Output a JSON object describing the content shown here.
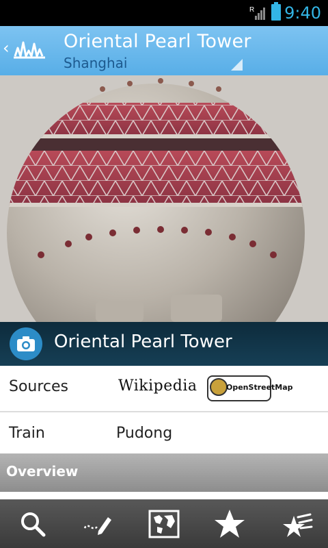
{
  "status_bar": {
    "time": "9:40",
    "signal_label": "R"
  },
  "header": {
    "title": "Oriental Pearl Tower",
    "subtitle": "Shanghai",
    "back_icon": "chevron-left-icon",
    "logo_icon": "city-skyline-icon"
  },
  "caption": {
    "title": "Oriental Pearl Tower",
    "icon": "camera-icon"
  },
  "rows": [
    {
      "label": "Sources",
      "wikipedia": "Wikipedia",
      "osm": "OpenStreetMap"
    },
    {
      "label": "Train",
      "value": "Pudong"
    }
  ],
  "overview": {
    "label": "Overview"
  },
  "nav": {
    "items": [
      {
        "icon": "search-icon"
      },
      {
        "icon": "edit-route-icon"
      },
      {
        "icon": "map-icon"
      },
      {
        "icon": "star-icon"
      },
      {
        "icon": "favorites-icon"
      }
    ]
  },
  "colors": {
    "accent": "#33b5e5",
    "header": "#6bb9ec",
    "caption_bar": "#123449"
  }
}
